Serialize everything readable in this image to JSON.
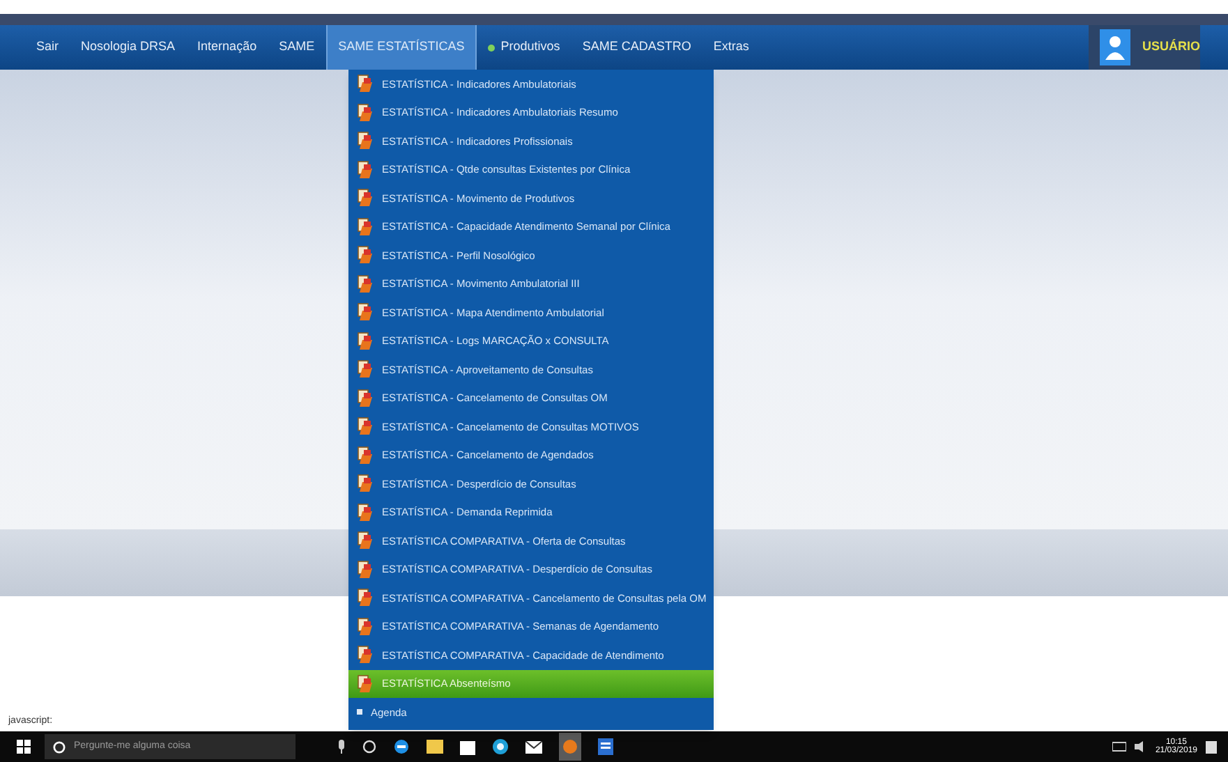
{
  "nav": {
    "items": [
      {
        "label": "Sair",
        "kind": "plain",
        "selected": false
      },
      {
        "label": "Nosologia DRSA",
        "kind": "plain",
        "selected": false
      },
      {
        "label": "Internação",
        "kind": "plain",
        "selected": false
      },
      {
        "label": "SAME",
        "kind": "plain",
        "selected": false
      },
      {
        "label": "SAME ESTATÍSTICAS",
        "kind": "plain",
        "selected": true
      },
      {
        "label": "Produtivos",
        "kind": "bullet",
        "selected": false
      },
      {
        "label": "SAME CADASTRO",
        "kind": "plain",
        "selected": false
      },
      {
        "label": "Extras",
        "kind": "plain",
        "selected": false
      }
    ],
    "user": "USUÁRIO"
  },
  "menu": {
    "items": [
      {
        "label": "ESTATÍSTICA - Indicadores Ambulatoriais",
        "kind": "icon",
        "selected": false
      },
      {
        "label": "ESTATÍSTICA - Indicadores Ambulatoriais Resumo",
        "kind": "icon",
        "selected": false
      },
      {
        "label": "ESTATÍSTICA - Indicadores Profissionais",
        "kind": "icon",
        "selected": false
      },
      {
        "label": "ESTATÍSTICA - Qtde consultas Existentes por Clínica",
        "kind": "icon",
        "selected": false
      },
      {
        "label": "ESTATÍSTICA - Movimento de Produtivos",
        "kind": "icon",
        "selected": false
      },
      {
        "label": "ESTATÍSTICA - Capacidade Atendimento Semanal por Clínica",
        "kind": "icon",
        "selected": false
      },
      {
        "label": "ESTATÍSTICA - Perfil Nosológico",
        "kind": "icon",
        "selected": false
      },
      {
        "label": "ESTATÍSTICA - Movimento Ambulatorial III",
        "kind": "icon",
        "selected": false
      },
      {
        "label": "ESTATÍSTICA - Mapa Atendimento Ambulatorial",
        "kind": "icon",
        "selected": false
      },
      {
        "label": "ESTATÍSTICA - Logs MARCAÇÃO x CONSULTA",
        "kind": "icon",
        "selected": false
      },
      {
        "label": "ESTATÍSTICA - Aproveitamento de Consultas",
        "kind": "icon",
        "selected": false
      },
      {
        "label": "ESTATÍSTICA - Cancelamento de Consultas OM",
        "kind": "icon",
        "selected": false
      },
      {
        "label": "ESTATÍSTICA - Cancelamento de Consultas MOTIVOS",
        "kind": "icon",
        "selected": false
      },
      {
        "label": "ESTATÍSTICA - Cancelamento de Agendados",
        "kind": "icon",
        "selected": false
      },
      {
        "label": "ESTATÍSTICA - Desperdício de Consultas",
        "kind": "icon",
        "selected": false
      },
      {
        "label": "ESTATÍSTICA - Demanda Reprimida",
        "kind": "icon",
        "selected": false
      },
      {
        "label": "ESTATÍSTICA COMPARATIVA - Oferta de Consultas",
        "kind": "icon",
        "selected": false
      },
      {
        "label": "ESTATÍSTICA COMPARATIVA - Desperdício de Consultas",
        "kind": "icon",
        "selected": false
      },
      {
        "label": "ESTATÍSTICA COMPARATIVA - Cancelamento de Consultas pela OM",
        "kind": "icon",
        "selected": false
      },
      {
        "label": "ESTATÍSTICA COMPARATIVA - Semanas de Agendamento",
        "kind": "icon",
        "selected": false
      },
      {
        "label": "ESTATÍSTICA COMPARATIVA - Capacidade de Atendimento",
        "kind": "icon",
        "selected": false
      },
      {
        "label": "ESTATÍSTICA Absenteísmo",
        "kind": "icon",
        "selected": true
      },
      {
        "label": "Agenda",
        "kind": "bullet",
        "selected": false
      }
    ]
  },
  "status_bar": "javascript:",
  "taskbar": {
    "search_placeholder": "Pergunte-me alguma coisa",
    "time": "10:15",
    "date": "21/03/2019"
  }
}
